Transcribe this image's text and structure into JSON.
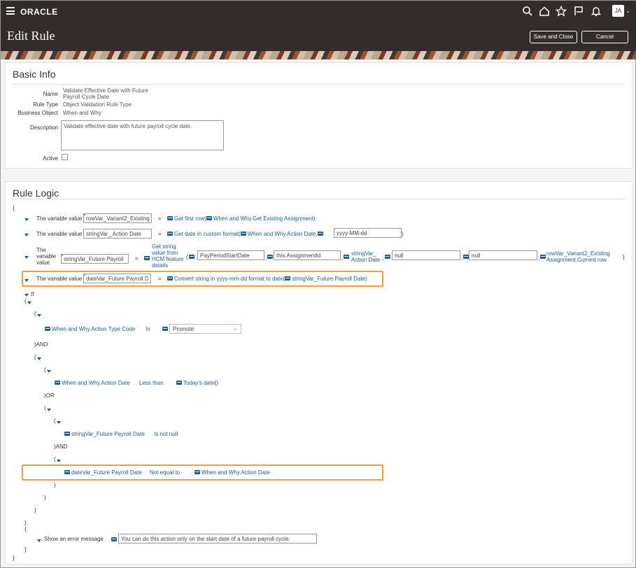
{
  "header": {
    "logo": "ORACLE",
    "title": "Edit Rule",
    "avatar": "JA",
    "save_close": "Save and Close",
    "cancel": "Cancel",
    "icons": [
      "search-icon",
      "home-icon",
      "star-icon",
      "flag-icon",
      "bell-icon"
    ]
  },
  "basic": {
    "title": "Basic Info",
    "name_label": "Name",
    "name_line1": "Validate Effective Date with Future",
    "name_line2": "Payroll Cycle Date",
    "type_label": "Rule Type",
    "type_value": "Object Validation Rule Type",
    "object_label": "Business Object",
    "object_value": "When and Why",
    "desc_label": "Description",
    "desc_value": "Validate effective date with future payroll cycle date.",
    "active_label": "Active"
  },
  "logic": {
    "title": "Rule Logic",
    "open_brace": "{",
    "close_brace": "}",
    "var_label": "The variable value",
    "var_label_1": "The",
    "var_label_2": "variable",
    "var_label_3": "value",
    "eq": "=",
    "comma": ",",
    "open_paren": "(",
    "close_paren": ")",
    "row1": {
      "var": "rowVar_Variant2_Existing",
      "func": "Get first row(",
      "arg": "When and Why.Get Existing Assignment",
      "end": ")"
    },
    "row2": {
      "var": "stringVar_ Action Date",
      "func": "Get date in custom format(",
      "arg1": "When and Why.Action Date,",
      "arg2": "yyyy-MM-dd",
      "end": ")"
    },
    "row3": {
      "var": "stringVar_Future Payroll",
      "func_1": "Get string",
      "func_2": "value from",
      "func_3": "HCM feature",
      "func_4": "details",
      "arg1": "PayPeriodStartDate",
      "arg2": "this.AssignmentId",
      "arg3_1": "stringVar_",
      "arg3_2": "Action Date",
      "arg4": "null",
      "arg5": "null",
      "arg6_1": "rowVar_Variant2_Existing",
      "arg6_2": "Assignment.Current row",
      "end": ")"
    },
    "row4": {
      "var": "dateVar_Future Payroll D",
      "func": "Convert string in yyyy-mm-dd format to date(",
      "arg": "stringVar_Future Payroll Date",
      "end": ")"
    },
    "if_label": "If",
    "paren_open": "(",
    "paren_close": ")",
    "and_close": ")AND",
    "or_close": ")OR",
    "cond1": {
      "left": "When and Why.Action Type Code",
      "op": "In",
      "value": "Promote"
    },
    "cond2": {
      "left": "When and Why.Action Date",
      "op": "Less than",
      "right": "Today's date",
      "right_end": "()"
    },
    "cond3": {
      "left": "stringVar_Future Payroll Date",
      "op": "Is not null"
    },
    "cond4": {
      "left": "dateVar_Future Payroll Date",
      "op": "Not equal to",
      "right": "When and Why.Action Date"
    },
    "error_label": "Show an error message",
    "error_value": "You can do this action only on the start date of a future payroll cycle."
  }
}
